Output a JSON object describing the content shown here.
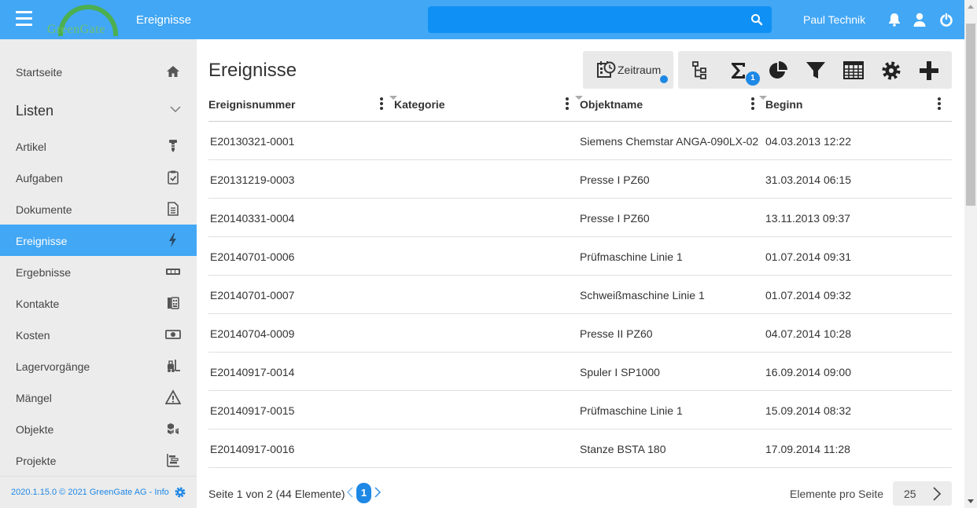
{
  "header": {
    "app_title": "Ereignisse",
    "logo_text": "GreenGate",
    "user_name": "Paul Technik",
    "search_value": "",
    "icons": [
      "menu-icon",
      "search-icon",
      "bell-icon",
      "user-icon",
      "power-icon"
    ],
    "bar_color": "#42a7f5"
  },
  "sidebar": {
    "home": {
      "label": "Startseite",
      "icon": "home-icon"
    },
    "section": {
      "label": "Listen",
      "icon": "chevron-down-icon"
    },
    "items": [
      {
        "label": "Artikel",
        "icon": "screw-icon"
      },
      {
        "label": "Aufgaben",
        "icon": "clipboard-check-icon"
      },
      {
        "label": "Dokumente",
        "icon": "document-icon"
      },
      {
        "label": "Ereignisse",
        "icon": "lightning-icon",
        "active": true
      },
      {
        "label": "Ergebnisse",
        "icon": "result-display-icon"
      },
      {
        "label": "Kontakte",
        "icon": "address-book-icon"
      },
      {
        "label": "Kosten",
        "icon": "money-icon"
      },
      {
        "label": "Lagervorgänge",
        "icon": "forklift-icon"
      },
      {
        "label": "Mängel",
        "icon": "warning-icon"
      },
      {
        "label": "Objekte",
        "icon": "cubes-icon"
      },
      {
        "label": "Projekte",
        "icon": "gantt-icon"
      }
    ],
    "footer": {
      "version": "2020.1.15.0 © 2021 GreenGate AG - Info",
      "icon": "gear-icon"
    }
  },
  "main": {
    "title": "Ereignisse",
    "toolbar": {
      "zeitraum_label": "Zeitraum",
      "aggregate_badge": "1",
      "icons": [
        "calendar-clock-icon",
        "tree-icon",
        "sigma-icon",
        "pie-chart-icon",
        "filter-icon",
        "table-icon",
        "gear-icon",
        "plus-icon"
      ]
    },
    "columns": [
      "Ereignisnummer",
      "Kategorie",
      "Objektname",
      "Beginn"
    ],
    "rows": [
      [
        "E20130321-0001",
        "",
        "Siemens Chemstar ANGA-090LX-02",
        "04.03.2013 12:22"
      ],
      [
        "E20131219-0003",
        "",
        "Presse I PZ60",
        "31.03.2014 06:15"
      ],
      [
        "E20140331-0004",
        "",
        "Presse I PZ60",
        "13.11.2013 09:37"
      ],
      [
        "E20140701-0006",
        "",
        "Prüfmaschine Linie 1",
        "01.07.2014 09:31"
      ],
      [
        "E20140701-0007",
        "",
        "Schweißmaschine Linie 1",
        "01.07.2014 09:32"
      ],
      [
        "E20140704-0009",
        "",
        "Presse II PZ60",
        "04.07.2014 10:28"
      ],
      [
        "E20140917-0014",
        "",
        "Spuler I SP1000",
        "16.09.2014 09:00"
      ],
      [
        "E20140917-0015",
        "",
        "Prüfmaschine Linie 1",
        "15.09.2014 08:32"
      ],
      [
        "E20140917-0016",
        "",
        "Stanze BSTA 180",
        "17.09.2014 11:28"
      ]
    ],
    "pager": {
      "info": "Seite 1 von 2 (44 Elemente)",
      "current_page": "1",
      "per_page_label": "Elemente pro Seite",
      "per_page_value": "25"
    }
  }
}
